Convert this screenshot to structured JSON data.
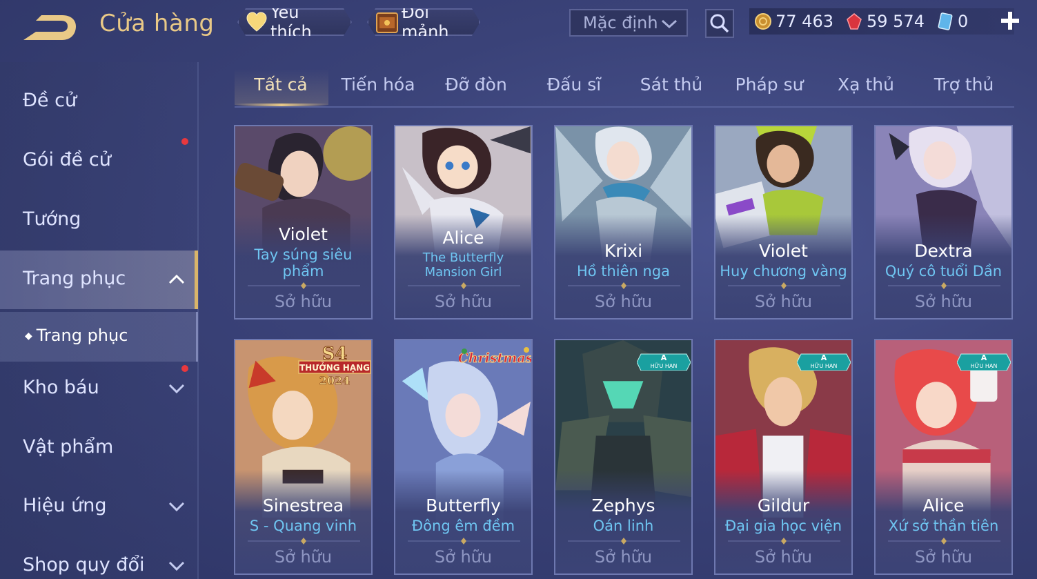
{
  "header": {
    "title": "Cửa hàng",
    "favorites_label": "Yêu thích",
    "exchange_label": "Đổi mảnh",
    "sort_value": "Mặc định",
    "currencies": [
      "77 463",
      "59 574",
      "0"
    ]
  },
  "sidebar": {
    "items": [
      "Đề cử",
      "Gói đề cử",
      "Tướng",
      "Trang phục",
      "Kho báu",
      "Vật phẩm",
      "Hiệu ứng",
      "Shop quy đổi"
    ],
    "sub_item": "Trang phục"
  },
  "tabs": [
    "Tất cả",
    "Tiến hóa",
    "Đỡ đòn",
    "Đấu sĩ",
    "Sát thủ",
    "Pháp sư",
    "Xạ thủ",
    "Trợ thủ"
  ],
  "cards": [
    {
      "hero": "Violet",
      "skin": "Tay súng siêu phẩm",
      "status": "Sở hữu"
    },
    {
      "hero": "Alice",
      "skin": "The Butterfly Mansion Girl",
      "status": "Sở hữu"
    },
    {
      "hero": "Krixi",
      "skin": "Hồ thiên nga",
      "status": "Sở hữu"
    },
    {
      "hero": "Violet",
      "skin": "Huy chương vàng",
      "status": "Sở hữu"
    },
    {
      "hero": "Dextra",
      "skin": "Quý cô tuổi Dần",
      "status": "Sở hữu"
    },
    {
      "hero": "Sinestrea",
      "skin": "S - Quang vinh",
      "status": "Sở hữu",
      "badge": "S4 THƯỞNG HẠNG 2024"
    },
    {
      "hero": "Butterfly",
      "skin": "Đông êm đềm",
      "status": "Sở hữu",
      "badge": "Christmas"
    },
    {
      "hero": "Zephys",
      "skin": "Oán linh",
      "status": "Sở hữu",
      "badge": "A HỮU HẠN"
    },
    {
      "hero": "Gildur",
      "skin": "Đại gia học viện",
      "status": "Sở hữu",
      "badge": "A HỮU HẠN"
    },
    {
      "hero": "Alice",
      "skin": "Xứ sở thần tiên",
      "status": "Sở hữu",
      "badge": "A HỮU HẠN"
    }
  ],
  "badges": {
    "s4_top": "S4",
    "s4_mid": "THƯỞNG HẠNG",
    "s4_year": "2024",
    "christmas": "Christmas",
    "limited_letter": "A",
    "limited_text": "HỮU HẠN"
  },
  "colors": {
    "accent_gold": "#e9c987",
    "skin_name_blue": "#6fc6f2",
    "owned_gray": "#8e96c2",
    "notification_red": "#e8383e"
  }
}
